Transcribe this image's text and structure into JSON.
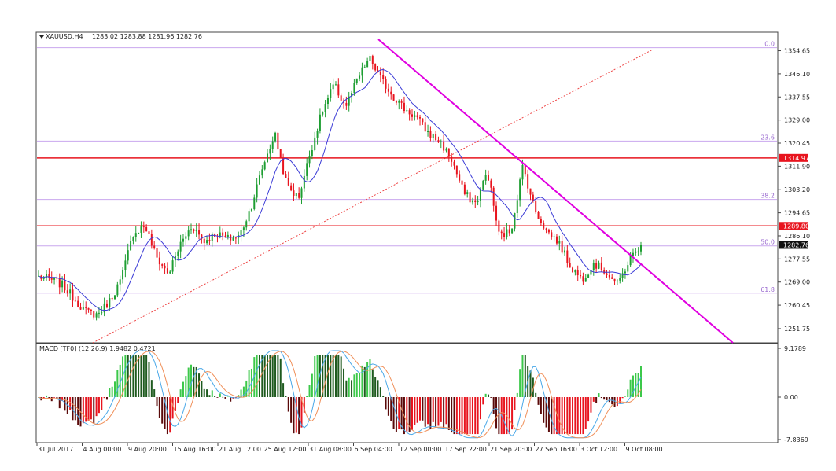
{
  "chart_data": {
    "type": "candlestick",
    "symbol": "XAUUSD,H4",
    "header_values": "1283.02 1283.88 1281.96 1282.76",
    "price_axis": {
      "range": [
        1246.5,
        1361.5
      ],
      "ticks": [
        "1354.65",
        "1346.10",
        "1337.55",
        "1329.00",
        "1320.45",
        "1311.90",
        "1303.20",
        "1294.65",
        "1286.10",
        "1277.55",
        "1269.00",
        "1260.45",
        "1251.75"
      ]
    },
    "price_tags": [
      {
        "value": 1314.97,
        "label": "1314.97",
        "color": "#e8141e"
      },
      {
        "value": 1289.8,
        "label": "1289.80",
        "color": "#e8141e"
      },
      {
        "value": 1282.76,
        "label": "1282.76",
        "color": "#111111"
      }
    ],
    "horizontal_levels": [
      {
        "value": 1314.97,
        "color": "#e8141e"
      },
      {
        "value": 1289.8,
        "color": "#e8141e"
      }
    ],
    "fibonacci_levels": [
      {
        "label": "0.0",
        "value": 1355.8
      },
      {
        "label": "23.6",
        "value": 1321.2
      },
      {
        "label": "38.2",
        "value": 1299.6
      },
      {
        "label": "50.0",
        "value": 1282.4
      },
      {
        "label": "61.8",
        "value": 1264.9
      }
    ],
    "x_axis_labels": [
      "31 Jul 2017",
      "4 Aug 00:00",
      "9 Aug 20:00",
      "15 Aug 16:00",
      "21 Aug 12:00",
      "25 Aug 12:00",
      "31 Aug 08:00",
      "6 Sep 04:00",
      "12 Sep 00:00",
      "17 Sep 22:00",
      "21 Sep 20:00",
      "27 Sep 16:00",
      "3 Oct 12:00",
      "9 Oct 08:00"
    ],
    "close_path": [
      1271,
      1270,
      1268,
      1263,
      1258,
      1257,
      1262,
      1270,
      1287,
      1290,
      1278,
      1272,
      1283,
      1290,
      1284,
      1287,
      1285,
      1286,
      1297,
      1312,
      1324,
      1305,
      1300,
      1317,
      1332,
      1342,
      1334,
      1344,
      1352,
      1344,
      1338,
      1333,
      1330,
      1324,
      1321,
      1314,
      1302,
      1298,
      1310,
      1286,
      1288,
      1312,
      1296,
      1288,
      1284,
      1275,
      1270,
      1276,
      1273,
      1268,
      1277,
      1283
    ],
    "candle_count": 230,
    "ma_lag": 5,
    "indicator": {
      "title": "MACD [TF0] (12,26,9) 1.9482 0.4721",
      "axis_labels": [
        "9.1789",
        "0.00",
        "-7.8369"
      ],
      "range": [
        -7.8369,
        9.1789
      ]
    },
    "colors": {
      "bull": "#1e9e32",
      "bear": "#e8141e",
      "ma": "#3b3bd6",
      "trendline": "#e000e0",
      "fib": "#c9a7ee",
      "fib_diag": "#ee4444",
      "macd_line": "#4aa8e8",
      "signal_line": "#f0905a"
    }
  }
}
